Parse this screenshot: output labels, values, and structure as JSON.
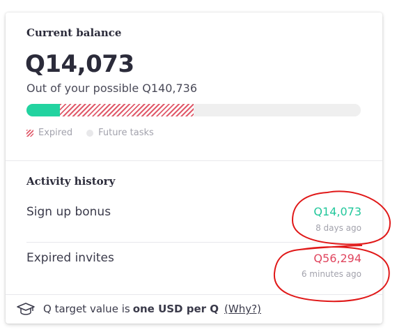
{
  "balance": {
    "title": "Current balance",
    "amount": "Q14,073",
    "subtext": "Out of your possible Q140,736",
    "progress": {
      "earned_fraction": 0.1,
      "expired_fraction": 0.4
    }
  },
  "legend": [
    {
      "label": "Expired"
    },
    {
      "label": "Future tasks"
    }
  ],
  "activity": {
    "title": "Activity history",
    "items": [
      {
        "label": "Sign up bonus",
        "amount": "Q14,073",
        "time": "8 days ago"
      },
      {
        "label": "Expired invites",
        "amount": "Q56,294",
        "time": "6 minutes ago"
      }
    ]
  },
  "footer": {
    "prefix": "Q target value is",
    "bold": "one USD per Q",
    "link": "(Why?)"
  },
  "colors": {
    "positive": "#22c79b",
    "negative": "#e0455e",
    "annotation": "#e01818"
  }
}
